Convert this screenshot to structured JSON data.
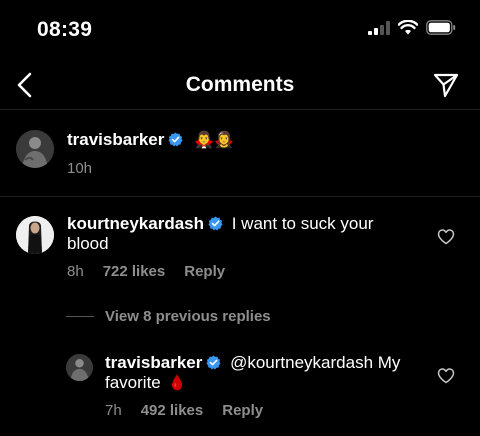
{
  "status_bar": {
    "time": "08:39"
  },
  "nav": {
    "title": "Comments"
  },
  "caption": {
    "username": "travisbarker",
    "emojis": "🧛‍♂️🧛‍♀️",
    "time": "10h"
  },
  "comments": [
    {
      "username": "kourtneykardash",
      "text": "I want to suck your blood",
      "time": "8h",
      "likes": "722 likes",
      "reply_label": "Reply"
    }
  ],
  "view_replies": {
    "label": "View 8 previous replies"
  },
  "reply": {
    "username": "travisbarker",
    "mention": "@kourtneykardash",
    "text_before": " My",
    "text_line2": "favorite",
    "time": "7h",
    "likes": "492 likes",
    "reply_label": "Reply"
  },
  "colors": {
    "background": "#000000",
    "text": "#ffffff",
    "secondary_text": "#8e8e8e",
    "verified": "#3897f0",
    "blood_drop": "#d10000"
  }
}
